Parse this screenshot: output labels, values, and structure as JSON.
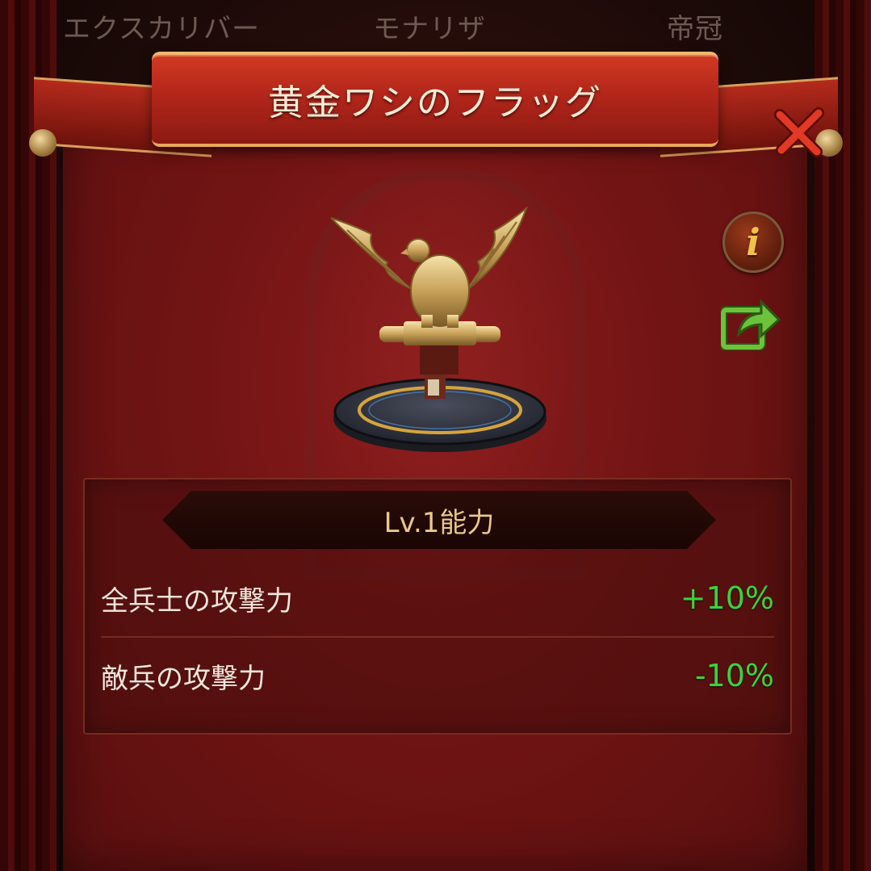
{
  "tabs": [
    "エクスカリバー",
    "モナリザ",
    "帝冠"
  ],
  "dialog": {
    "title": "黄金ワシのフラッグ"
  },
  "icons": {
    "close": "close-x-icon",
    "info": "info-icon",
    "share": "share-icon",
    "artifact": "golden-eagle-standard"
  },
  "info_glyph": "i",
  "ability": {
    "level_label": "Lv.1能力",
    "stats": [
      {
        "label": "全兵士の攻撃力",
        "value": "+10%"
      },
      {
        "label": "敵兵の攻撃力",
        "value": "-10%"
      }
    ]
  },
  "colors": {
    "panel": "#7a1616",
    "banner": "#c02e1e",
    "level_text": "#e8c98c",
    "stat_value": "#39d33a"
  }
}
